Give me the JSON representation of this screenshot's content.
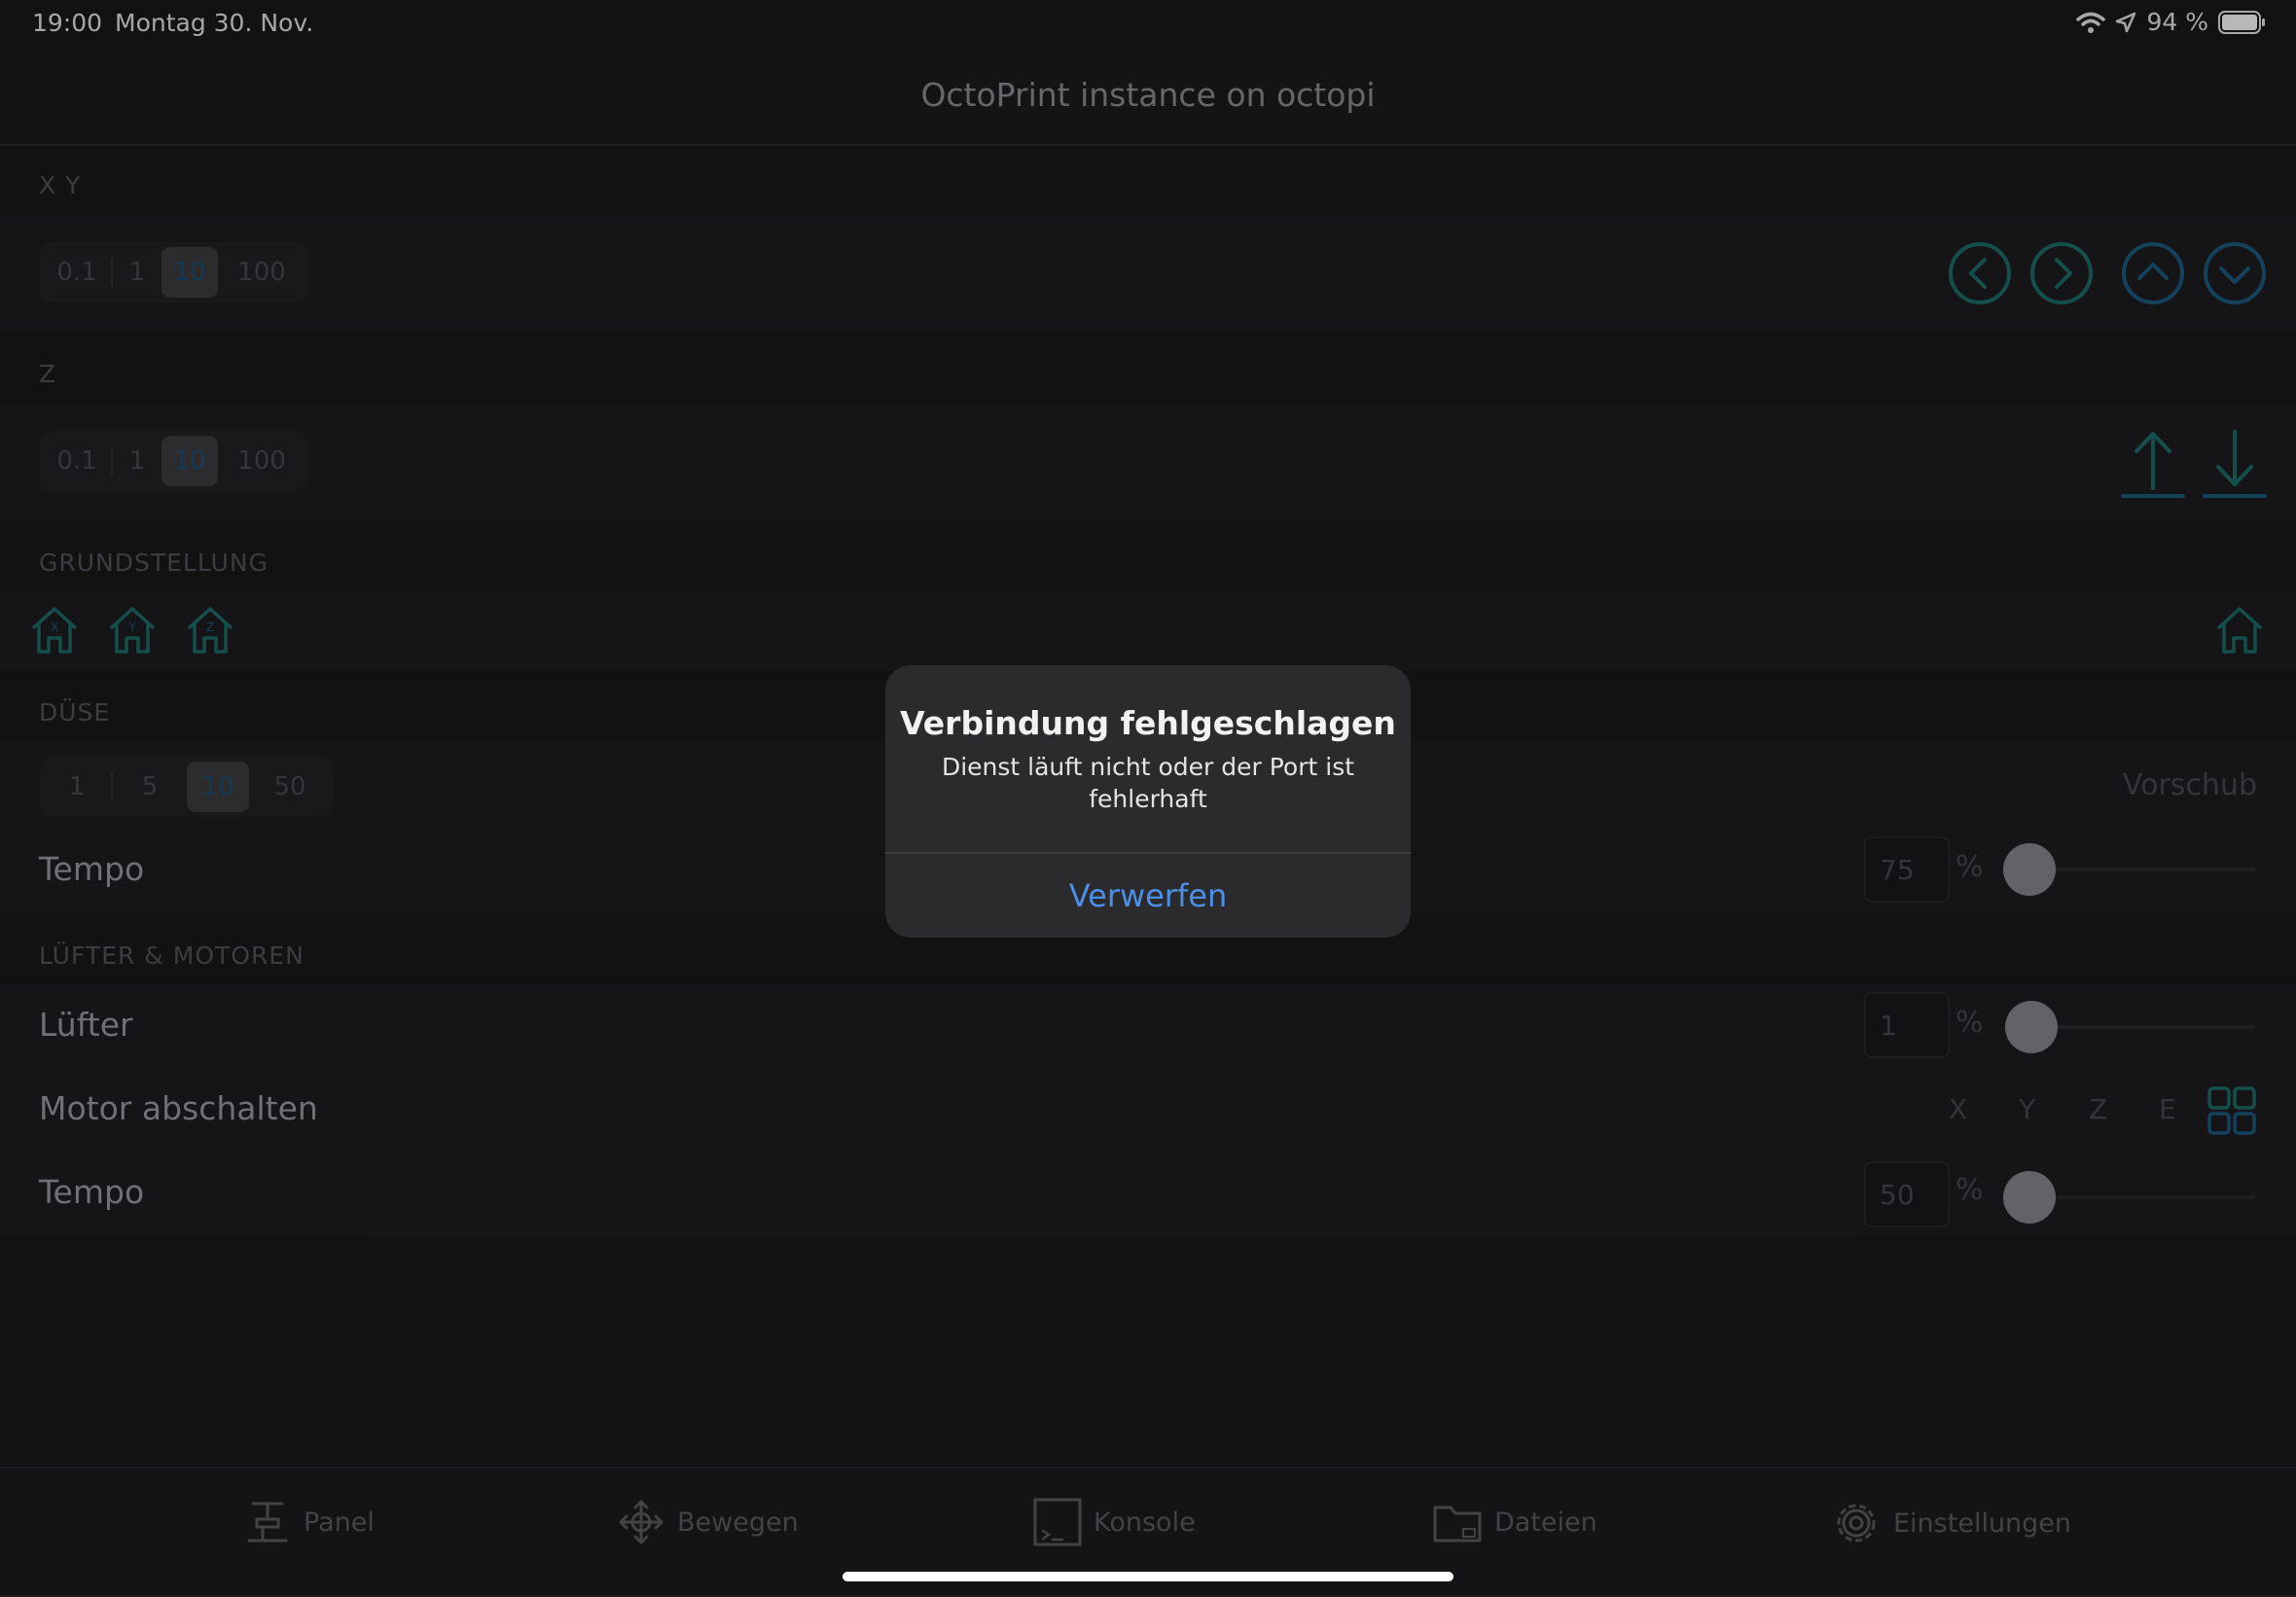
{
  "status": {
    "time": "19:00",
    "date": "Montag 30. Nov.",
    "battery": "94 %"
  },
  "nav": {
    "title": "OctoPrint instance on octopi"
  },
  "xy": {
    "header": "X Y",
    "steps": [
      "0.1",
      "1",
      "10",
      "100"
    ],
    "selected": "10"
  },
  "z": {
    "header": "Z",
    "steps": [
      "0.1",
      "1",
      "10",
      "100"
    ],
    "selected": "10"
  },
  "home": {
    "header": "GRUNDSTELLUNG",
    "axes": [
      "X",
      "Y",
      "Z"
    ]
  },
  "nozzle": {
    "header": "DÜSE",
    "steps": [
      "1",
      "5",
      "10",
      "50"
    ],
    "selected": "10",
    "feed_label": "Vorschub",
    "speed_label": "Tempo",
    "speed_value": "75",
    "percent": "%",
    "speed_level": 0.75
  },
  "fans": {
    "header": "LÜFTER & MOTOREN",
    "fan_label": "Lüfter",
    "fan_value": "1",
    "fan_level": 0.01,
    "motor_label": "Motor abschalten",
    "motor_axes": [
      "X",
      "Y",
      "Z",
      "E"
    ],
    "tempo_label": "Tempo",
    "tempo_value": "50",
    "tempo_level": 0.5,
    "percent": "%"
  },
  "alert": {
    "title": "Verbindung fehlgeschlagen",
    "message": "Dienst läuft nicht oder der Port ist fehlerhaft",
    "button": "Verwerfen"
  },
  "tabs": [
    "Panel",
    "Bewegen",
    "Konsole",
    "Dateien",
    "Einstellungen"
  ],
  "colors": {
    "accent": "#1e6e6a",
    "accent2": "#1d5a80",
    "alert_button": "#4c8fe8"
  }
}
